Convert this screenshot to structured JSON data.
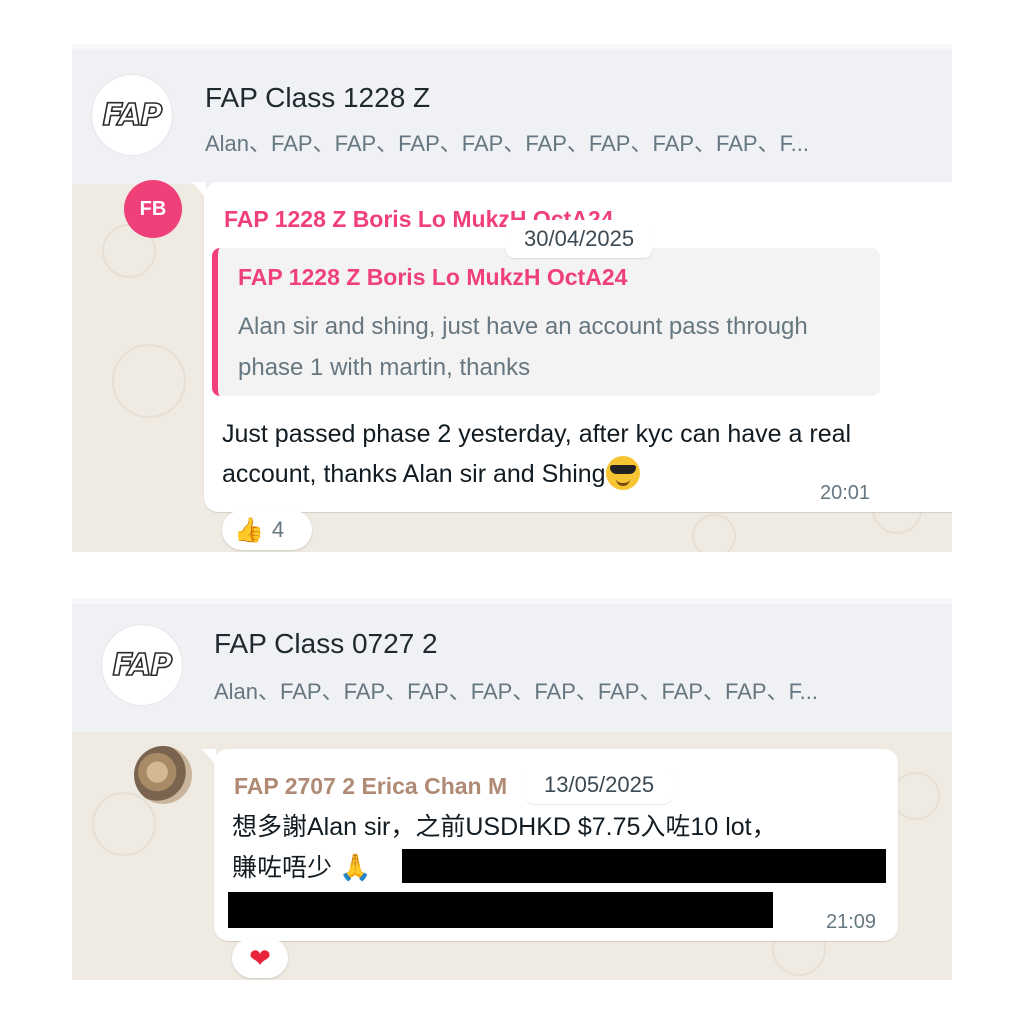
{
  "chats": [
    {
      "group_name": "FAP Class 1228 Z",
      "members": "Alan、FAP、FAP、FAP、FAP、FAP、FAP、FAP、FAP、F...",
      "logo_text": "FAP",
      "avatar_initials": "FB",
      "date": "30/04/2025",
      "sender": "FAP 1228 Z Boris Lo MukzH OctA24",
      "quote": {
        "sender": "FAP 1228 Z Boris Lo MukzH OctA24",
        "text": "Alan sir and shing, just have an account pass through phase 1 with martin, thanks"
      },
      "message": "Just passed phase 2 yesterday, after kyc can have a real account, thanks Alan sir and Shing",
      "time": "20:01",
      "reaction": {
        "icon": "thumbs-up-icon",
        "emoji": "👍",
        "count": "4"
      }
    },
    {
      "group_name": "FAP Class 0727 2",
      "members": "Alan、FAP、FAP、FAP、FAP、FAP、FAP、FAP、FAP、F...",
      "logo_text": "FAP",
      "date": "13/05/2025",
      "sender": "FAP 2707 2 Erica Chan M",
      "message_line1": "想多謝Alan sir，之前USDHKD $7.75入咗10 lot，",
      "message_line2": "賺咗唔少",
      "message_emoji": "🙏",
      "time": "21:09",
      "reaction": {
        "icon": "heart-icon",
        "emoji": "❤"
      }
    }
  ],
  "colors": {
    "header_bg": "#eff1f4",
    "chat_bg": "#efeae2",
    "sender_pink": "#f0407a",
    "sender_brown": "#b08a74",
    "meta_gray": "#667781"
  }
}
